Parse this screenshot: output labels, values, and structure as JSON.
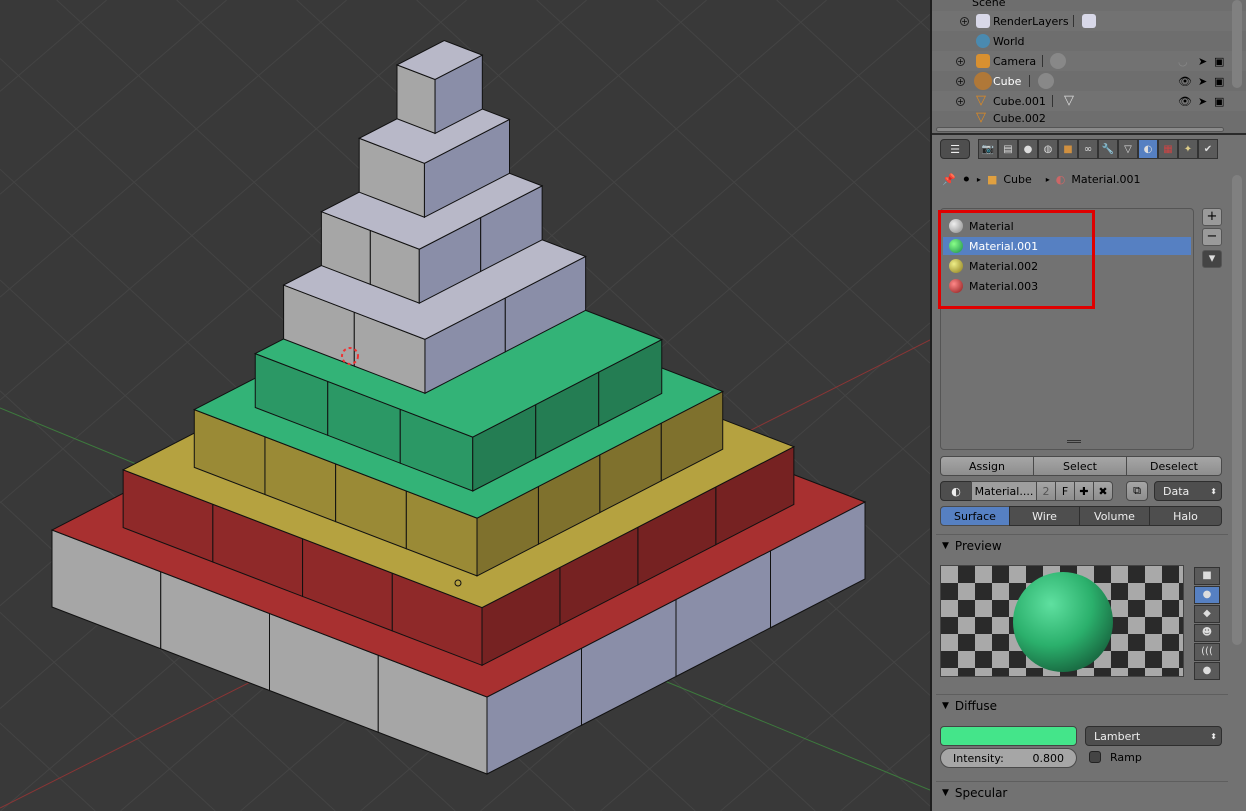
{
  "outliner": {
    "rows": [
      {
        "label": "Scene"
      },
      {
        "label": "RenderLayers"
      },
      {
        "label": "World"
      },
      {
        "label": "Camera"
      },
      {
        "label": "Cube"
      },
      {
        "label": "Cube.001"
      },
      {
        "label": "Cube.002"
      }
    ]
  },
  "properties": {
    "tabs": [
      "render-icon",
      "render-layers-icon",
      "scene-icon",
      "world-icon",
      "object-icon",
      "constraints-icon",
      "modifier-icon",
      "data-icon",
      "material-icon",
      "texture-icon",
      "particles-icon",
      "physics-icon"
    ],
    "breadcrumb": {
      "object": "Cube",
      "material": "Material.001"
    },
    "materials": [
      {
        "name": "Material",
        "color": "#b0b0b0"
      },
      {
        "name": "Material.001",
        "color": "#2ec070",
        "selected": true
      },
      {
        "name": "Material.002",
        "color": "#c0a830"
      },
      {
        "name": "Material.003",
        "color": "#c02020"
      }
    ],
    "assign_label": "Assign",
    "select_label": "Select",
    "deselect_label": "Deselect",
    "material_field": "Material....",
    "users": "2",
    "fake_user": "F",
    "link": "Data",
    "type_tabs": [
      "Surface",
      "Wire",
      "Volume",
      "Halo"
    ],
    "preview_label": "Preview",
    "diffuse_label": "Diffuse",
    "diffuse_color": "#44e58a",
    "shader": "Lambert",
    "intensity_label": "Intensity:",
    "intensity_value": "0.800",
    "ramp_label": "Ramp",
    "specular_label": "Specular"
  },
  "viewport": {
    "colors": {
      "red": "#a83030",
      "yellow": "#b5a240",
      "green": "#33b377",
      "grey": "#a8a8a8",
      "bg": "#393939"
    }
  }
}
